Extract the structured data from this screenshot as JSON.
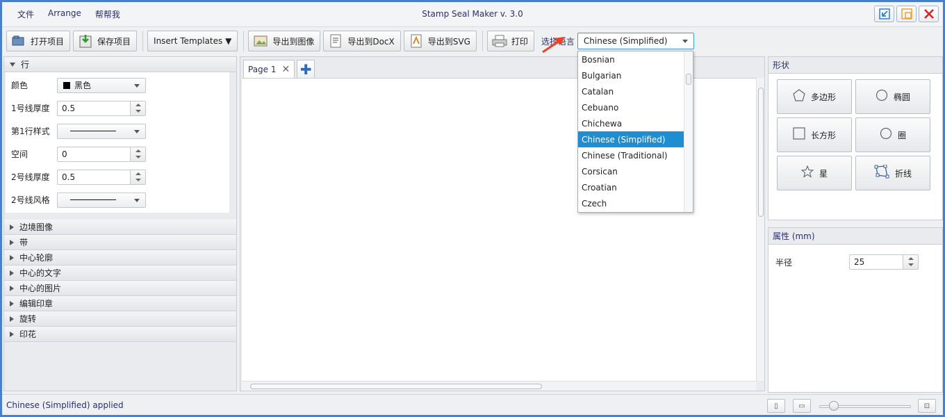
{
  "menu": [
    "文件",
    "Arrange",
    "帮帮我"
  ],
  "window_title": "Stamp Seal Maker v. 3.0",
  "toolbar": {
    "open": "打开项目",
    "save": "保存项目",
    "templates": "Insert Templates ▼",
    "export_image": "导出到图像",
    "export_docx": "导出到DocX",
    "export_svg": "导出到SVG",
    "print": "打印",
    "lang_label": "选择语言",
    "lang_value": "Chinese (Simplified)"
  },
  "language_options": [
    "Bosnian",
    "Bulgarian",
    "Catalan",
    "Cebuano",
    "Chichewa",
    "Chinese (Simplified)",
    "Chinese (Traditional)",
    "Corsican",
    "Croatian",
    "Czech"
  ],
  "language_selected_index": 5,
  "left_panel": {
    "expanded_section": "行",
    "props": {
      "color_label": "颜色",
      "color_value": "黑色",
      "line1_width_label": "1号线厚度",
      "line1_width_value": "0.5",
      "line1_style_label": "第1行样式",
      "space_label": "空间",
      "space_value": "0",
      "line2_width_label": "2号线厚度",
      "line2_width_value": "0.5",
      "line2_style_label": "2号线风格"
    },
    "sections": [
      "边境图像",
      "带",
      "中心轮廓",
      "中心的文字",
      "中心的图片",
      "编辑印章",
      "旋转",
      "印花"
    ]
  },
  "tabs": {
    "page": "Page 1",
    "add": "✚"
  },
  "shapes_panel": {
    "title": "形状",
    "items": [
      "多边形",
      "椭圆",
      "长方形",
      "圈",
      "星",
      "折线"
    ]
  },
  "properties_panel": {
    "title": "属性 (mm)",
    "radius_label": "半径",
    "radius_value": "25"
  },
  "status": "Chinese (Simplified) applied",
  "colors": {
    "accent": "#1e8ed1",
    "text_dark": "#2b2f6a",
    "arrow": "#e8432b"
  }
}
